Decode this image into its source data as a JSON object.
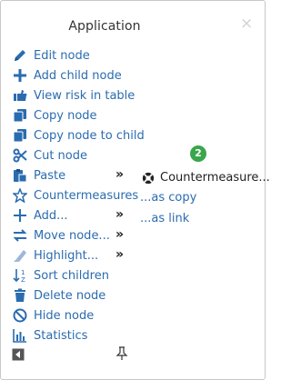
{
  "dialog": {
    "title": "Application",
    "close_glyph": "×"
  },
  "menu": [
    {
      "label": "Edit node",
      "icon": "pencil-icon"
    },
    {
      "label": "Add child node",
      "icon": "plus-icon"
    },
    {
      "label": "View risk in table",
      "icon": "hand-point-icon"
    },
    {
      "label": "Copy node",
      "icon": "copy-icon"
    },
    {
      "label": "Copy node to child",
      "icon": "copy-icon"
    },
    {
      "label": "Cut node",
      "icon": "scissors-icon"
    },
    {
      "label": "Paste",
      "icon": "paste-icon",
      "submenu": true
    },
    {
      "label": "Countermeasures",
      "icon": "star-outline-icon"
    },
    {
      "label": "Add...",
      "icon": "plus-icon",
      "submenu": true
    },
    {
      "label": "Move node...",
      "icon": "arrows-exchange-icon",
      "submenu": true
    },
    {
      "label": "Highlight...",
      "icon": "highlighter-icon",
      "submenu": true
    },
    {
      "label": "Sort children",
      "icon": "sort-icon"
    },
    {
      "label": "Delete node",
      "icon": "trash-icon"
    },
    {
      "label": "Hide node",
      "icon": "ban-icon"
    },
    {
      "label": "Statistics",
      "icon": "bar-chart-icon"
    }
  ],
  "submenu_glyph": "»",
  "paste_submenu": {
    "badge": "2",
    "item_label": "Countermeasure...",
    "as_copy": "...as copy",
    "as_link": "...as link"
  },
  "footer": {
    "collapse_icon": "caret-left-icon",
    "pin_icon": "pin-icon"
  },
  "colors": {
    "link": "#2a6cb0",
    "badge": "#3aa64c"
  }
}
